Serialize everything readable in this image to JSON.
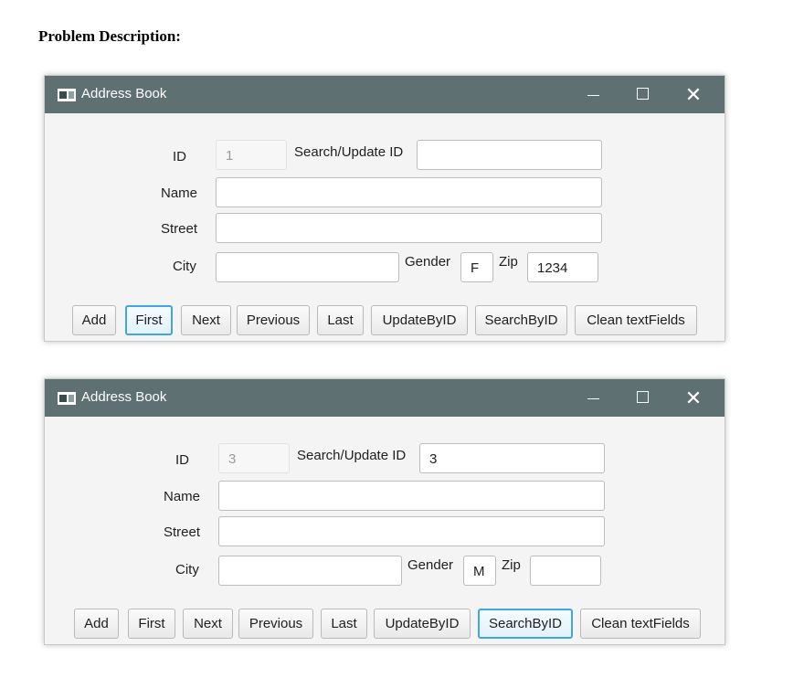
{
  "problem_heading": "Problem Description:",
  "windows": [
    {
      "title": "Address Book",
      "controls": {
        "minimize": "minimize-icon",
        "maximize": "maximize-icon",
        "close": "close-icon"
      },
      "labels": {
        "id": "ID",
        "search_update_id": "Search/Update ID",
        "name": "Name",
        "street": "Street",
        "city": "City",
        "gender": "Gender",
        "zip": "Zip"
      },
      "values": {
        "id": "1",
        "search_update_id": "",
        "name": "",
        "street": "",
        "city": "",
        "gender": "F",
        "zip": "1234"
      },
      "buttons": [
        "Add",
        "First",
        "Next",
        "Previous",
        "Last",
        "UpdateByID",
        "SearchByID",
        "Clean textFields"
      ],
      "focused_button": "First"
    },
    {
      "title": "Address Book",
      "controls": {
        "minimize": "minimize-icon",
        "maximize": "maximize-icon",
        "close": "close-icon"
      },
      "labels": {
        "id": "ID",
        "search_update_id": "Search/Update ID",
        "name": "Name",
        "street": "Street",
        "city": "City",
        "gender": "Gender",
        "zip": "Zip"
      },
      "values": {
        "id": "3",
        "search_update_id": "3",
        "name": "",
        "street": "",
        "city": "",
        "gender": "M",
        "zip": ""
      },
      "buttons": [
        "Add",
        "First",
        "Next",
        "Previous",
        "Last",
        "UpdateByID",
        "SearchByID",
        "Clean textFields"
      ],
      "focused_button": "SearchByID"
    }
  ],
  "colors": {
    "titlebar": "#5f7072",
    "focus_ring": "#3fa6e0",
    "window_bg": "#f4f4f4"
  }
}
